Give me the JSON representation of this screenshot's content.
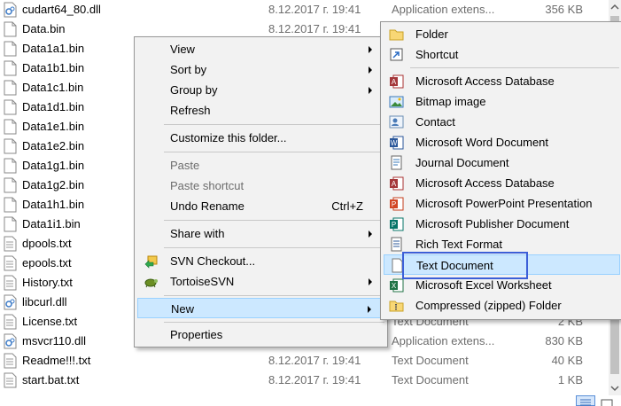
{
  "files": [
    {
      "name": "cudart64_80.dll",
      "date": "8.12.2017 г. 19:41",
      "type": "Application extens...",
      "size": "356 KB",
      "icon": "dll-icon"
    },
    {
      "name": "Data.bin",
      "date": "8.12.2017 г. 19:41",
      "type": "",
      "size": "",
      "icon": "file-icon"
    },
    {
      "name": "Data1a1.bin",
      "date": "",
      "type": "",
      "size": "",
      "icon": "file-icon"
    },
    {
      "name": "Data1b1.bin",
      "date": "",
      "type": "",
      "size": "",
      "icon": "file-icon"
    },
    {
      "name": "Data1c1.bin",
      "date": "",
      "type": "",
      "size": "",
      "icon": "file-icon"
    },
    {
      "name": "Data1d1.bin",
      "date": "",
      "type": "",
      "size": "",
      "icon": "file-icon"
    },
    {
      "name": "Data1e1.bin",
      "date": "",
      "type": "",
      "size": "",
      "icon": "file-icon"
    },
    {
      "name": "Data1e2.bin",
      "date": "",
      "type": "",
      "size": "",
      "icon": "file-icon"
    },
    {
      "name": "Data1g1.bin",
      "date": "",
      "type": "",
      "size": "",
      "icon": "file-icon"
    },
    {
      "name": "Data1g2.bin",
      "date": "",
      "type": "",
      "size": "",
      "icon": "file-icon"
    },
    {
      "name": "Data1h1.bin",
      "date": "",
      "type": "",
      "size": "",
      "icon": "file-icon"
    },
    {
      "name": "Data1i1.bin",
      "date": "",
      "type": "",
      "size": "",
      "icon": "file-icon"
    },
    {
      "name": "dpools.txt",
      "date": "",
      "type": "",
      "size": "",
      "icon": "text-file-icon"
    },
    {
      "name": "epools.txt",
      "date": "",
      "type": "",
      "size": "",
      "icon": "text-file-icon"
    },
    {
      "name": "History.txt",
      "date": "",
      "type": "",
      "size": "",
      "icon": "text-file-icon"
    },
    {
      "name": "libcurl.dll",
      "date": "",
      "type": "",
      "size": "",
      "icon": "dll-icon"
    },
    {
      "name": "License.txt",
      "date": "",
      "type": "Text Document",
      "size": "2 KB",
      "icon": "text-file-icon"
    },
    {
      "name": "msvcr110.dll",
      "date": "",
      "type": "Application extens...",
      "size": "830 KB",
      "icon": "dll-icon"
    },
    {
      "name": "Readme!!!.txt",
      "date": "8.12.2017 г. 19:41",
      "type": "Text Document",
      "size": "40 KB",
      "icon": "text-file-icon"
    },
    {
      "name": "start.bat.txt",
      "date": "8.12.2017 г. 19:41",
      "type": "Text Document",
      "size": "1 KB",
      "icon": "text-file-icon"
    }
  ],
  "context_menu": {
    "items": [
      {
        "label": "View",
        "submenu": true
      },
      {
        "label": "Sort by",
        "submenu": true
      },
      {
        "label": "Group by",
        "submenu": true
      },
      {
        "label": "Refresh"
      },
      {
        "label": "Customize this folder..."
      },
      {
        "label": "Paste",
        "disabled": true
      },
      {
        "label": "Paste shortcut",
        "disabled": true
      },
      {
        "label": "Undo Rename",
        "shortcut": "Ctrl+Z"
      },
      {
        "label": "Share with",
        "submenu": true
      },
      {
        "label": "SVN Checkout...",
        "icon": "svn-checkout-icon"
      },
      {
        "label": "TortoiseSVN",
        "icon": "tortoisesvn-icon",
        "submenu": true
      },
      {
        "label": "New",
        "submenu": true,
        "highlighted": true
      },
      {
        "label": "Properties"
      }
    ]
  },
  "new_submenu": {
    "items": [
      {
        "label": "Folder",
        "icon": "folder-icon"
      },
      {
        "label": "Shortcut",
        "icon": "shortcut-icon"
      },
      {
        "label": "Microsoft Access Database",
        "icon": "access-icon"
      },
      {
        "label": "Bitmap image",
        "icon": "bitmap-icon"
      },
      {
        "label": "Contact",
        "icon": "contact-icon"
      },
      {
        "label": "Microsoft Word Document",
        "icon": "word-icon"
      },
      {
        "label": "Journal Document",
        "icon": "journal-icon"
      },
      {
        "label": "Microsoft Access Database",
        "icon": "access-icon"
      },
      {
        "label": "Microsoft PowerPoint Presentation",
        "icon": "powerpoint-icon"
      },
      {
        "label": "Microsoft Publisher Document",
        "icon": "publisher-icon"
      },
      {
        "label": "Rich Text Format",
        "icon": "rtf-icon"
      },
      {
        "label": "Text Document",
        "icon": "text-document-icon",
        "highlighted": true
      },
      {
        "label": "Microsoft Excel Worksheet",
        "icon": "excel-icon"
      },
      {
        "label": "Compressed (zipped) Folder",
        "icon": "zip-folder-icon"
      }
    ]
  },
  "colors": {
    "menu_background": "#f2f2f2",
    "menu_highlight": "#91c9f7",
    "submenu_highlight": "#cce8ff",
    "focus_border": "#3c5fd8",
    "secondary_text": "#6d6d6d"
  }
}
